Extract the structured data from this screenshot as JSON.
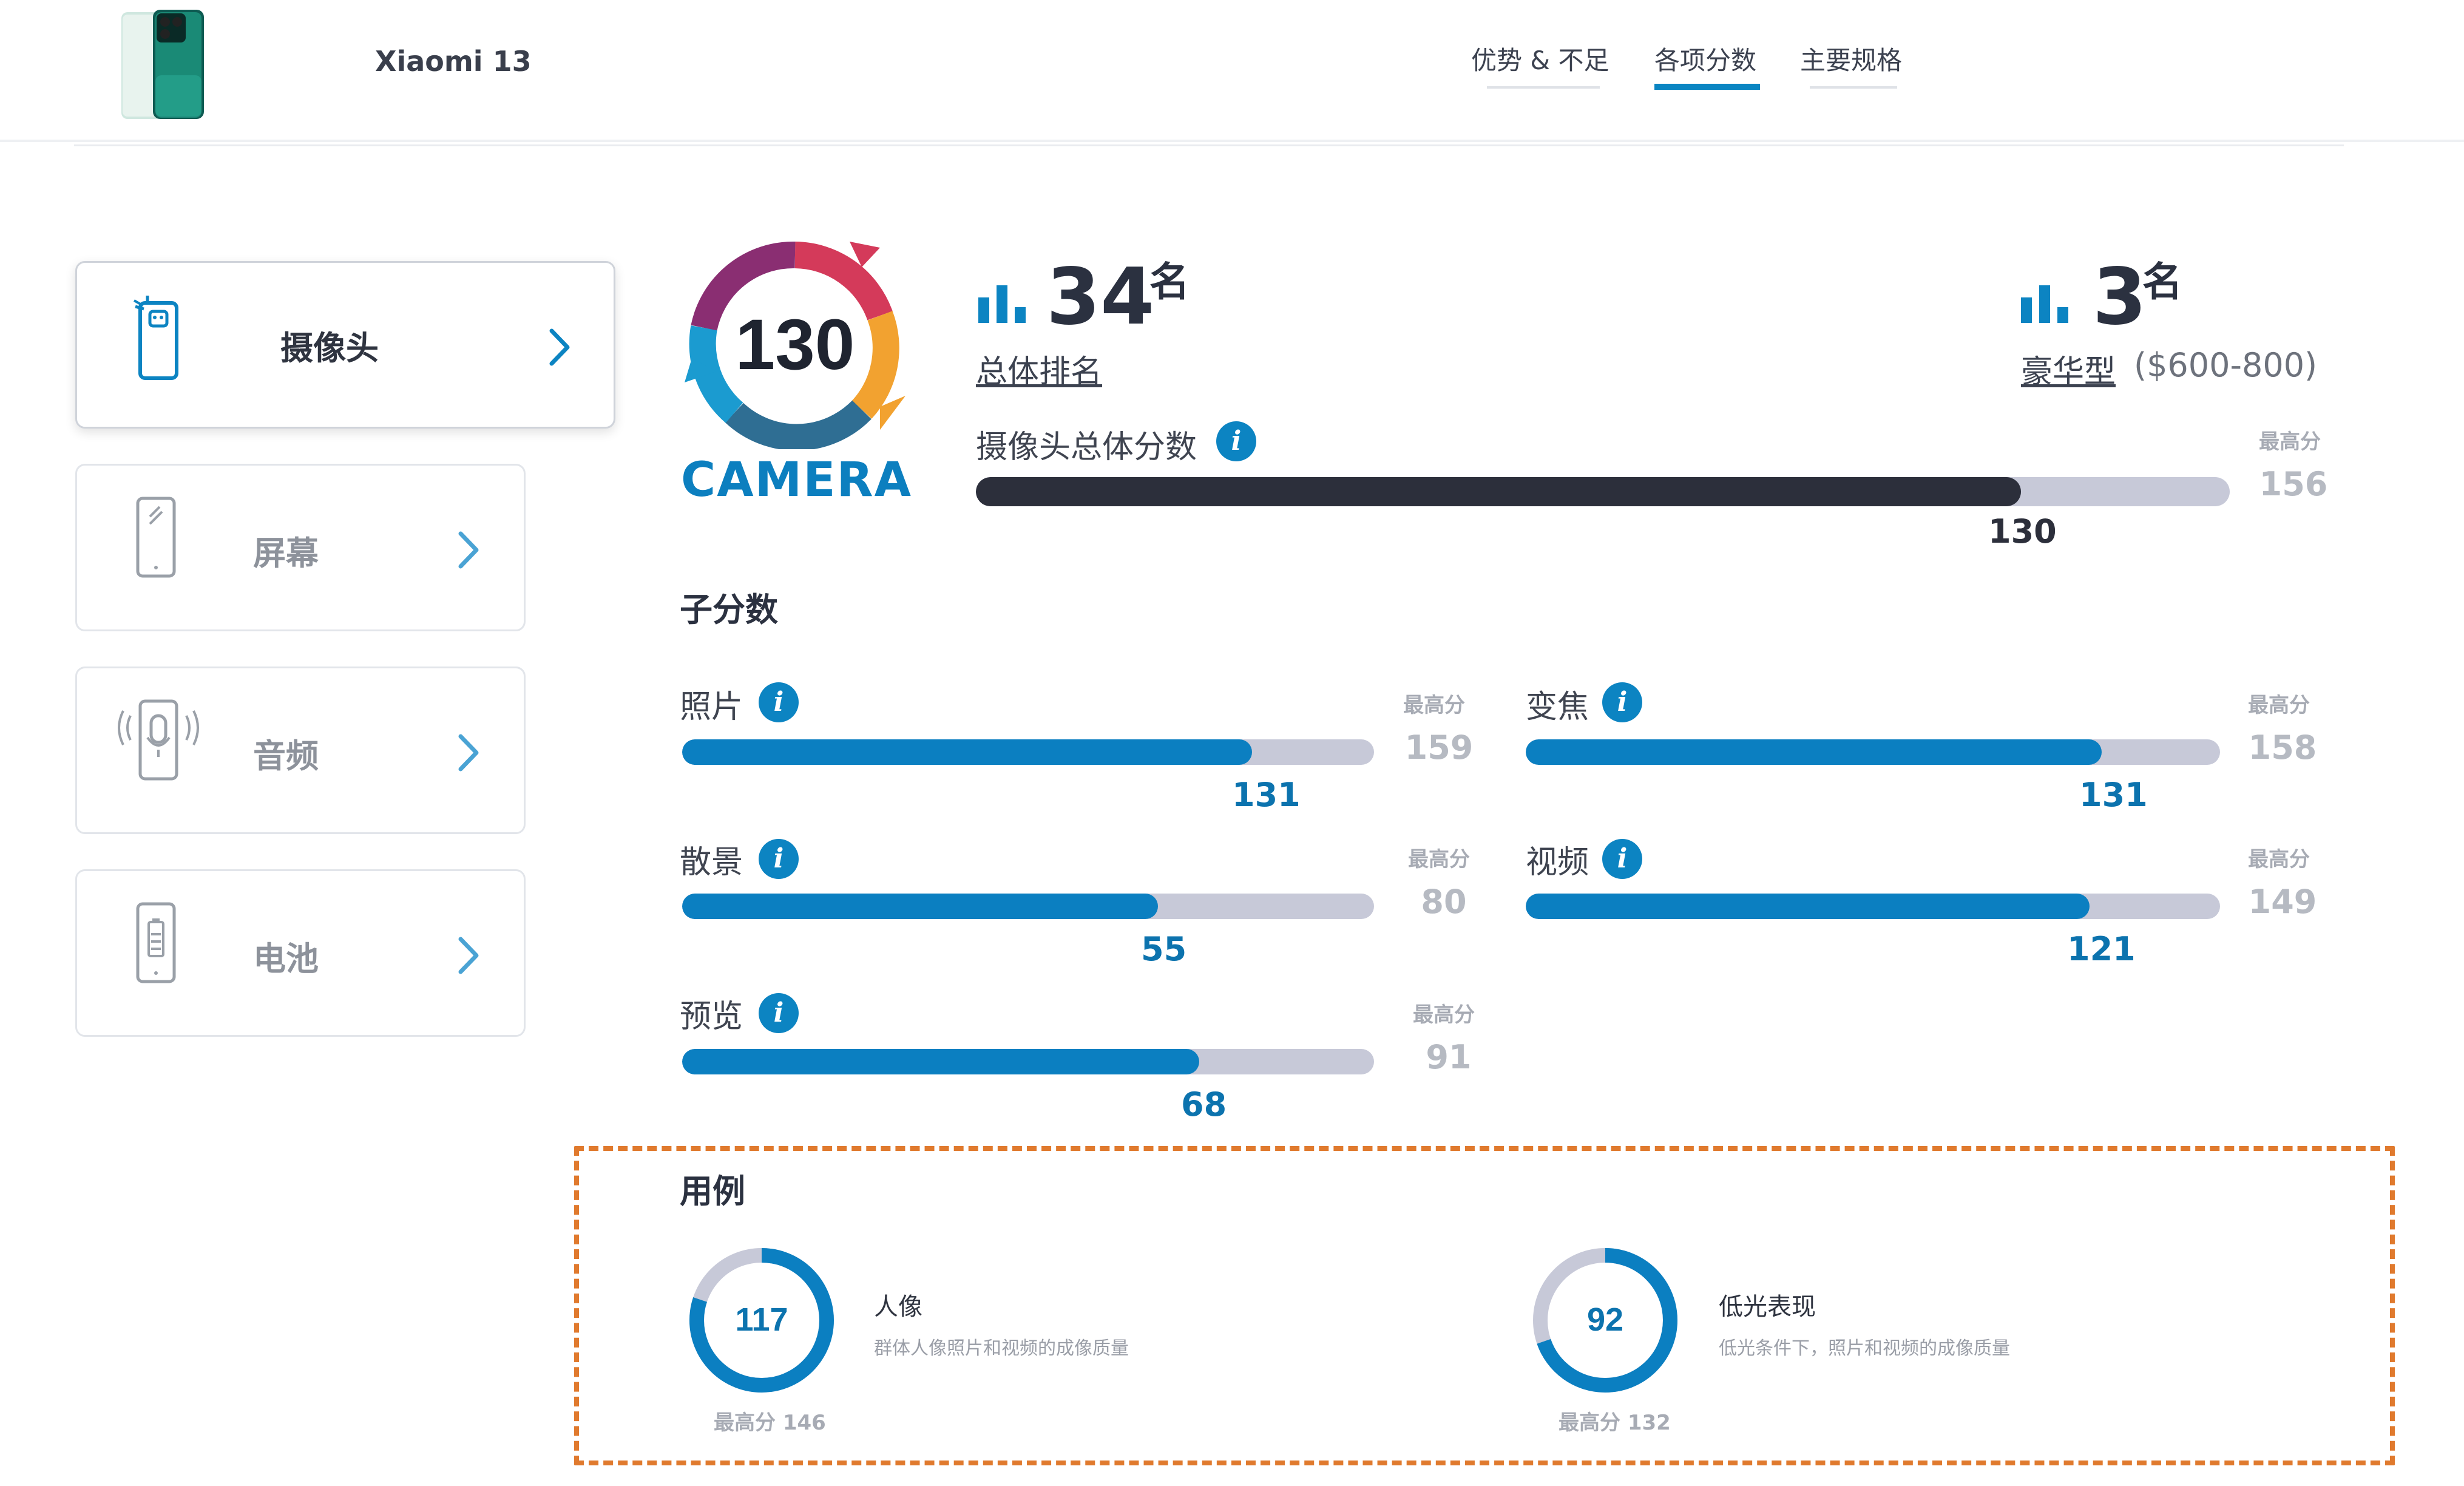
{
  "header": {
    "device_name": "Xiaomi 13",
    "tabs": [
      {
        "label": "优势 & 不足",
        "active": false
      },
      {
        "label": "各项分数",
        "active": true
      },
      {
        "label": "主要规格",
        "active": false
      }
    ]
  },
  "sidebar": {
    "items": [
      {
        "label": "摄像头",
        "icon": "camera-phone-icon",
        "active": true
      },
      {
        "label": "屏幕",
        "icon": "screen-phone-icon",
        "active": false
      },
      {
        "label": "音频",
        "icon": "audio-phone-icon",
        "active": false
      },
      {
        "label": "电池",
        "icon": "battery-phone-icon",
        "active": false
      }
    ]
  },
  "camera": {
    "score": "130",
    "label": "CAMERA",
    "overall_rank": {
      "number": "34",
      "suffix": "名",
      "label": "总体排名"
    },
    "segment_rank": {
      "number": "3",
      "suffix": "名",
      "label": "豪华型",
      "price": "($600-800)"
    },
    "total": {
      "label": "摄像头总体分数",
      "max_caption": "最高分",
      "max": 156,
      "value": 130
    }
  },
  "subscores": {
    "title": "子分数",
    "max_caption": "最高分",
    "items": [
      {
        "label": "照片",
        "value": 131,
        "max": 159
      },
      {
        "label": "变焦",
        "value": 131,
        "max": 158
      },
      {
        "label": "散景",
        "value": 55,
        "max": 80
      },
      {
        "label": "视频",
        "value": 121,
        "max": 149
      },
      {
        "label": "预览",
        "value": 68,
        "max": 91
      }
    ]
  },
  "use_cases": {
    "title": "用例",
    "items": [
      {
        "title": "人像",
        "desc": "群体人像照片和视频的成像质量",
        "value": 117,
        "max_label": "最高分 146",
        "max": 146
      },
      {
        "title": "低光表现",
        "desc": "低光条件下，照片和视频的成像质量",
        "value": 92,
        "max_label": "最高分 132",
        "max": 132
      }
    ]
  },
  "colors": {
    "accent": "#0b7fc1",
    "main_bar": "#2c2f3b",
    "track": "#c7c9d8",
    "highlight_frame": "#e07a2e"
  }
}
